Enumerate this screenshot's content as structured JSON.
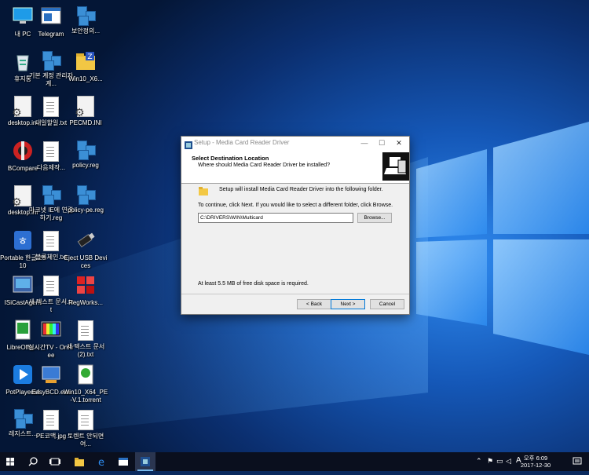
{
  "desktop": {
    "icons": [
      {
        "label": "내 PC",
        "icon": "computer-icon"
      },
      {
        "label": "Telegram",
        "icon": "app-window-icon"
      },
      {
        "label": "보안정의...",
        "icon": "registry-icon"
      },
      {
        "label": "휴지통",
        "icon": "recycle-bin-icon"
      },
      {
        "label": "기본 계정 관리자 계...",
        "icon": "registry-icon"
      },
      {
        "label": "Win10_X6...",
        "icon": "zip-folder-icon"
      },
      {
        "label": "desktop.ini",
        "icon": "settings-file-icon"
      },
      {
        "label": "내일할일.txt",
        "icon": "text-file-icon"
      },
      {
        "label": "PECMD.INI",
        "icon": "settings-file-icon"
      },
      {
        "label": "BCompare",
        "icon": "bcompare-icon"
      },
      {
        "label": "다음제작...",
        "icon": "text-file-icon"
      },
      {
        "label": "policy.reg",
        "icon": "registry-icon"
      },
      {
        "label": "desktop.ini",
        "icon": "settings-file-icon"
      },
      {
        "label": "마크넷 IE에 연결하기.reg",
        "icon": "registry-icon"
      },
      {
        "label": "policy-pe.reg",
        "icon": "registry-icon"
      },
      {
        "label": "Portable 한글 2010",
        "icon": "hwp-icon"
      },
      {
        "label": "블록체인.txt",
        "icon": "text-file-icon"
      },
      {
        "label": "Eject USB Devices",
        "icon": "usb-icon"
      },
      {
        "label": "ISiCastAgent",
        "icon": "isicast-icon"
      },
      {
        "label": "새 텍스트 문서.txt",
        "icon": "text-file-icon"
      },
      {
        "label": "RegWorks...",
        "icon": "regworks-icon"
      },
      {
        "label": "LibreOffic...",
        "icon": "libreoffice-icon"
      },
      {
        "label": "실시간TV - OnFree",
        "icon": "tv-icon"
      },
      {
        "label": "새 텍스트 문서 (2).txt",
        "icon": "text-file-icon"
      },
      {
        "label": "PotPlayer64",
        "icon": "potplayer-icon"
      },
      {
        "label": "EasyBCD.exe",
        "icon": "easybcd-icon"
      },
      {
        "label": "Win10_X64_PE-V.1.torrent",
        "icon": "torrent-icon"
      },
      {
        "label": "레지스트...",
        "icon": "registry-icon"
      },
      {
        "label": "PE코맥.jpg",
        "icon": "image-file-icon"
      },
      {
        "label": "토렌트 안되면 여...",
        "icon": "text-file-icon"
      }
    ]
  },
  "dialog": {
    "title": "Setup - Media Card Reader Driver",
    "minimize_label": "—",
    "maximize_label": "☐",
    "close_label": "✕",
    "header_title": "Select Destination Location",
    "header_subtitle": "Where should Media Card Reader Driver be installed?",
    "intro": "Setup will install Media Card Reader Driver into the following folder.",
    "instruction": "To continue, click Next. If you would like to select a different folder, click Browse.",
    "path": "C:\\DRIVERS\\WIN\\Multicard",
    "browse_label": "Browse...",
    "space_required": "At least 5.5 MB of free disk space is required.",
    "back_label": "< Back",
    "next_label": "Next >",
    "cancel_label": "Cancel"
  },
  "taskbar": {
    "tray_ime": "A",
    "time": "오후 6:09",
    "date": "2017-12-30",
    "pinned": [
      {
        "icon": "file-explorer-icon",
        "color": "#f3c844"
      },
      {
        "icon": "edge-icon",
        "color": "#1e90ff"
      },
      {
        "icon": "telegram-window-icon",
        "color": "#5ea7e0"
      },
      {
        "icon": "setup-app-icon",
        "color": "#1f4f8f"
      }
    ]
  },
  "colors": {
    "accent": "#0078d7",
    "taskbar": "#0a0f1e",
    "wallpaper_dark": "#06204f",
    "wallpaper_light": "#1a73d9"
  }
}
